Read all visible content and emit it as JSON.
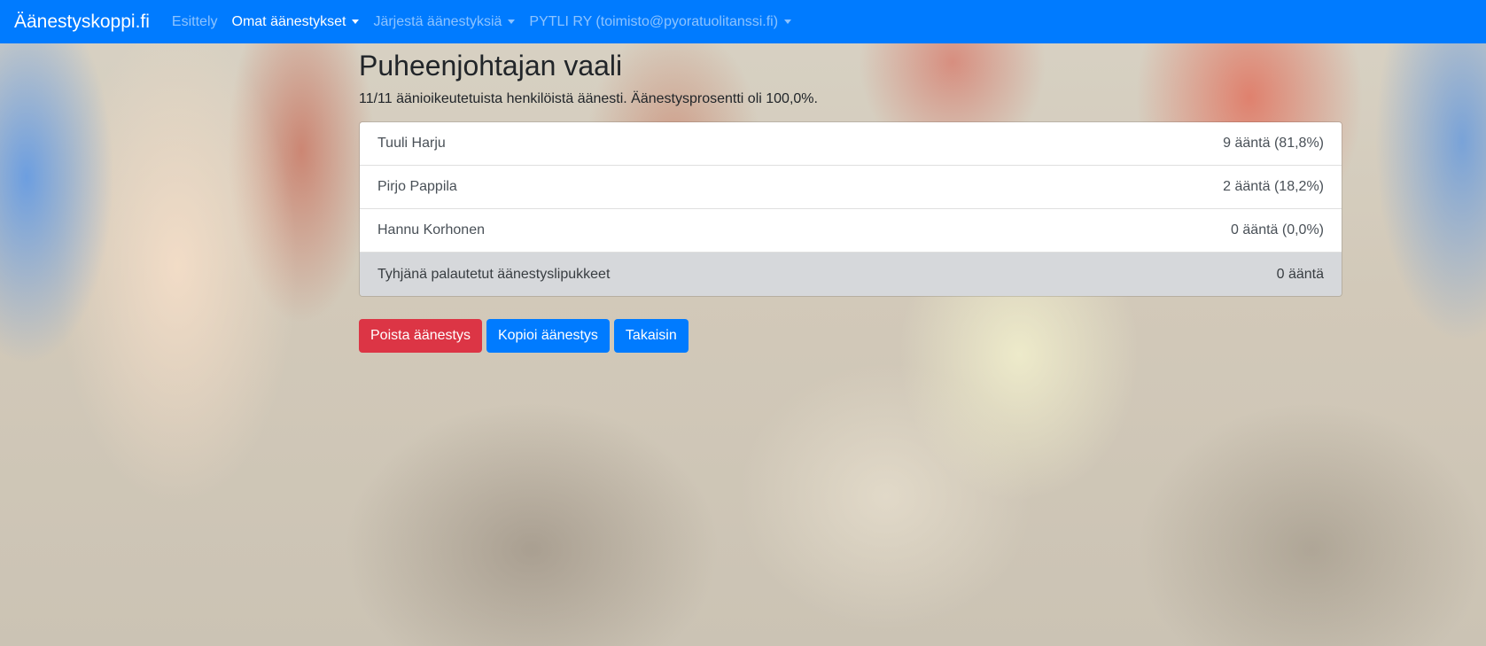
{
  "navbar": {
    "brand": "Äänestyskoppi.fi",
    "links": [
      {
        "label": "Esittely",
        "active": false,
        "dropdown": false
      },
      {
        "label": "Omat äänestykset",
        "active": true,
        "dropdown": true
      },
      {
        "label": "Järjestä äänestyksiä",
        "active": false,
        "dropdown": true
      },
      {
        "label": "PYTLI RY (toimisto@pyoratuolitanssi.fi)",
        "active": false,
        "dropdown": true
      }
    ]
  },
  "poll": {
    "title": "Puheenjohtajan vaali",
    "summary": "11/11 äänioikeutetuista henkilöistä äänesti. Äänestysprosentti oli 100,0%.",
    "results": [
      {
        "name": "Tuuli Harju",
        "votes": "9 ääntä (81,8%)"
      },
      {
        "name": "Pirjo Pappila",
        "votes": "2 ääntä (18,2%)"
      },
      {
        "name": "Hannu Korhonen",
        "votes": "0 ääntä (0,0%)"
      }
    ],
    "blank": {
      "name": "Tyhjänä palautetut äänestyslipukkeet",
      "votes": "0 ääntä"
    }
  },
  "actions": {
    "delete_label": "Poista äänestys",
    "copy_label": "Kopioi äänestys",
    "back_label": "Takaisin"
  },
  "colors": {
    "navbar": "#007bff",
    "danger": "#dc3545",
    "primary": "#007bff"
  }
}
